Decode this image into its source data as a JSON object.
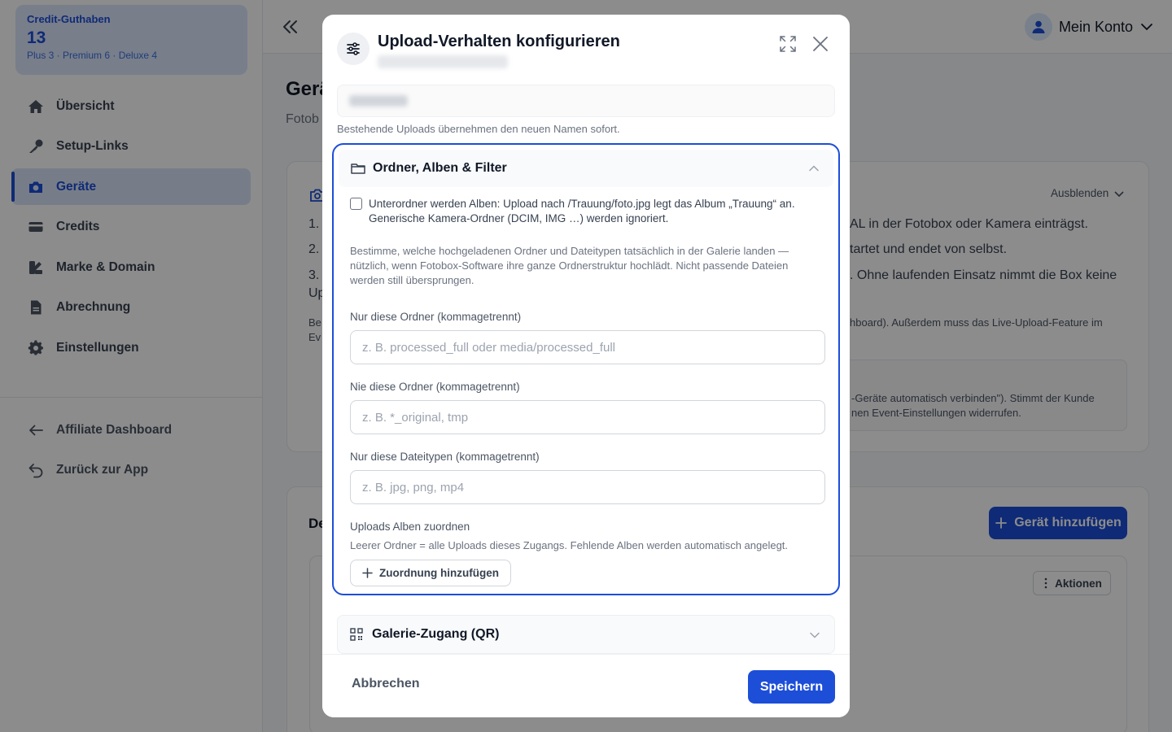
{
  "sidebar": {
    "credit": {
      "label": "Credit-Guthaben",
      "value": "13",
      "breakdown": "Plus 3 · Premium 6 · Deluxe 4"
    },
    "items": [
      {
        "label": "Übersicht",
        "icon": "home-icon"
      },
      {
        "label": "Setup-Links",
        "icon": "key-icon"
      },
      {
        "label": "Geräte",
        "icon": "camera-icon",
        "active": true
      },
      {
        "label": "Credits",
        "icon": "card-icon"
      },
      {
        "label": "Marke & Domain",
        "icon": "brush-icon"
      },
      {
        "label": "Abrechnung",
        "icon": "document-icon"
      },
      {
        "label": "Einstellungen",
        "icon": "gear-icon"
      }
    ],
    "footer_items": [
      {
        "label": "Affiliate Dashboard",
        "icon": "arrow-left-icon"
      },
      {
        "label": "Zurück zur App",
        "icon": "return-icon"
      }
    ]
  },
  "header": {
    "account_label": "Mein Konto"
  },
  "background": {
    "title": "Gerä",
    "subtitle": "Fotob",
    "hide_label": "Ausblenden",
    "line1": "AL in der Fotobox oder Kamera einträgst.",
    "line2": "tartet und endet von selbst.",
    "line3": ". Ohne laufenden Einsatz nimmt die Box keine",
    "line4": "hboard). Außerdem muss das Live-Upload-Feature im",
    "notice_line1": "-Geräte automatisch verbinden\"). Stimmt der Kunde",
    "notice_line2": "nen Event-Einstellungen widerrufen.",
    "num1": "1.",
    "num2": "2.",
    "num3": "3.",
    "frag_up": "Up",
    "frag_be": "Be",
    "frag_ev": "Ev",
    "section_frag": "De",
    "add_device_label": "Gerät hinzufügen",
    "actions_label": "Aktionen"
  },
  "modal": {
    "title": "Upload-Verhalten konfigurieren",
    "name_hint": "Bestehende Uploads übernehmen den neuen Namen sofort.",
    "section": {
      "title": "Ordner, Alben & Filter",
      "checkbox_line1": "Unterordner werden Alben: Upload nach /Trauung/foto.jpg legt das Album „Trauung“ an.",
      "checkbox_line2": "Generische Kamera-Ordner (DCIM, IMG …) werden ignoriert.",
      "checkbox_checked": false,
      "description": "Bestimme, welche hochgeladenen Ordner und Dateitypen tatsächlich in der Galerie landen — nützlich, wenn Fotobox-Software ihre ganze Ordnerstruktur hochlädt. Nicht passende Dateien werden still übersprungen.",
      "fields": [
        {
          "label": "Nur diese Ordner (kommagetrennt)",
          "placeholder": "z. B. processed_full oder media/processed_full",
          "value": ""
        },
        {
          "label": "Nie diese Ordner (kommagetrennt)",
          "placeholder": "z. B. *_original, tmp",
          "value": ""
        },
        {
          "label": "Nur diese Dateitypen (kommagetrennt)",
          "placeholder": "z. B. jpg, png, mp4",
          "value": ""
        }
      ],
      "mapping_label": "Uploads Alben zuordnen",
      "mapping_hint": "Leerer Ordner = alle Uploads dieses Zugangs. Fehlende Alben werden automatisch angelegt.",
      "add_mapping_label": "Zuordnung hinzufügen"
    },
    "section2_title": "Galerie-Zugang (QR)",
    "cancel_label": "Abbrechen",
    "save_label": "Speichern"
  },
  "colors": {
    "accent": "#1d4ed8",
    "overlay": "rgba(0,0,0,0.45)"
  }
}
